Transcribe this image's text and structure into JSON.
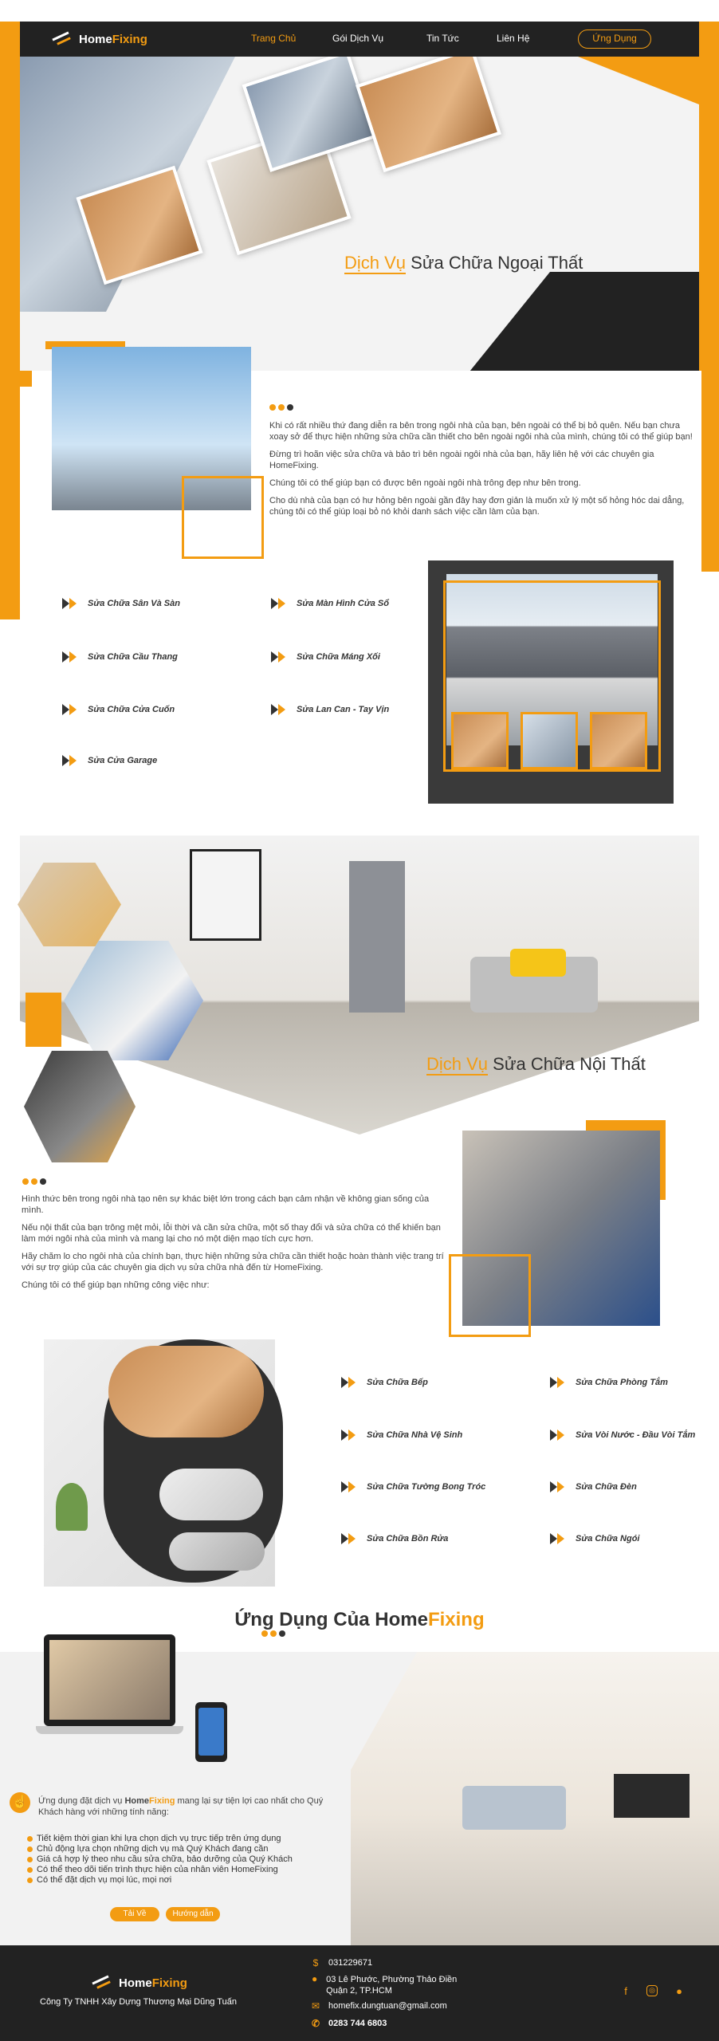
{
  "nav": {
    "brand_home": "Home",
    "brand_fixing": "Fixing",
    "links": [
      "Trang Chủ",
      "Gói Dịch Vụ",
      "Tin Tức",
      "Liên Hệ"
    ],
    "app_button": "Ứng Dụng"
  },
  "hero": {
    "title_highlight": "Dịch Vụ",
    "title_rest": " Sửa Chữa Ngoại Thất"
  },
  "exterior": {
    "paragraphs": [
      "Khi có rất nhiều thứ đang diễn ra bên trong ngôi nhà của bạn, bên ngoài có thể bị bỏ quên. Nếu bạn chưa xoay sở để thực hiện những sửa chữa cần thiết cho bên ngoài ngôi nhà của mình, chúng tôi có thể giúp bạn!",
      "Đừng trì hoãn việc sửa chữa và bảo trì bên ngoài ngôi nhà của bạn, hãy liên hệ với các chuyên gia HomeFixing.",
      "Chúng tôi có thể giúp bạn có được bên ngoài ngôi nhà trông đẹp như bên trong.",
      "Cho dù nhà của bạn có hư hỏng bên ngoài gần đây hay đơn giản là muốn xử lý một số hỏng hóc dai dẳng, chúng tôi có thể giúp loại bỏ nó khỏi danh sách việc cần làm của bạn."
    ],
    "services_left": [
      "Sửa Chữa Sân Và Sàn",
      "Sửa Chữa Cầu Thang",
      "Sửa Chữa Cửa Cuốn",
      "Sửa Cửa Garage"
    ],
    "services_right": [
      "Sửa Màn Hình Cửa Sổ",
      "Sửa Chữa Máng Xối",
      "Sửa Lan Can - Tay Vịn"
    ]
  },
  "interior": {
    "title_highlight": "Dịch Vụ",
    "title_rest": " Sửa Chữa Nội Thất",
    "paragraphs": [
      "Hình thức bên trong ngôi nhà tạo nên sự khác biệt lớn trong cách bạn cảm nhận về không gian sống của mình.",
      "Nếu nội thất của bạn trông mệt mỏi, lỗi thời và cần sửa chữa, một số thay đổi và sửa chữa có thể khiến bạn làm mới ngôi nhà của mình và mang lại cho nó một diện mạo tích cực hơn.",
      "Hãy chăm lo cho ngôi nhà của chính bạn, thực hiện những sửa chữa cần thiết hoặc hoàn thành việc trang trí với sự trợ giúp của các chuyên gia dịch vụ sửa chữa nhà đến từ HomeFixing.",
      "Chúng tôi có thể giúp bạn những công việc như:"
    ],
    "services_left": [
      "Sửa Chữa Bếp",
      "Sửa Chữa Nhà Vệ Sinh",
      "Sửa Chữa Tường Bong Tróc",
      "Sửa Chữa Bồn Rửa"
    ],
    "services_right": [
      "Sửa Chữa Phòng Tắm",
      "Sửa Vòi Nước - Đầu Vòi Tắm",
      "Sửa Chữa Đèn",
      "Sửa Chữa Ngói"
    ]
  },
  "app": {
    "title_prefix": "Ứng Dụng Của Home",
    "title_suffix": "Fixing",
    "intro_before": "Ứng dụng đặt dịch vụ ",
    "intro_brand_home": "Home",
    "intro_brand_fixing": "Fixing",
    "intro_after": " mang lại sự tiện lợi cao nhất cho Quý Khách hàng với những tính năng:",
    "features": [
      "Tiết kiệm thời gian khi lựa chọn dịch vụ trực tiếp trên ứng dụng",
      "Chủ động lựa chọn những dịch vụ mà Quý Khách đang cần",
      "Giá cả hợp lý theo nhu cầu sửa chữa, bảo dưỡng của Quý Khách",
      "Có thể theo dõi tiến trình thực hiện của nhân viên HomeFixing",
      "Có thể đặt dịch vụ mọi lúc, mọi nơi"
    ],
    "download": "Tải Về",
    "guide": "Hướng dẫn"
  },
  "footer": {
    "brand_home": "Home",
    "brand_fixing": "Fixing",
    "company": "Công Ty TNHH Xây Dựng Thương Mại Dũng Tuấn",
    "tax": "031229671",
    "address": "03 Lê Phước, Phường Thảo Điền Quận 2, TP.HCM",
    "email": "homefix.dungtuan@gmail.com",
    "phone": "0283 744 6803"
  }
}
